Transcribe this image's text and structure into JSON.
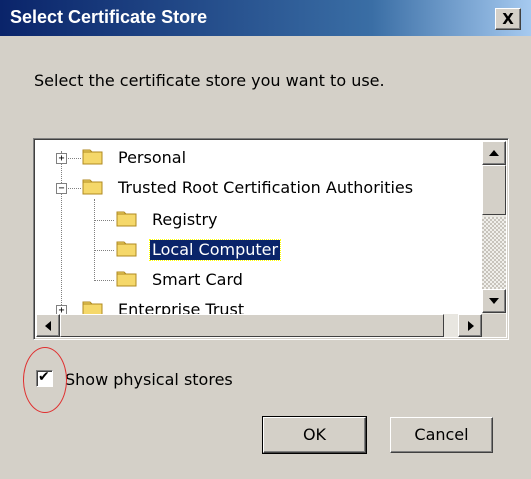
{
  "dialog": {
    "title": "Select Certificate Store",
    "close_glyph": "X",
    "prompt": "Select the certificate store you want to use."
  },
  "tree": {
    "nodes": [
      {
        "label": "Personal",
        "expander": "+"
      },
      {
        "label": "Trusted Root Certification Authorities",
        "expander": "−"
      },
      {
        "label": "Registry"
      },
      {
        "label": "Local Computer",
        "selected": true
      },
      {
        "label": "Smart Card"
      },
      {
        "label": "Enterprise Trust",
        "expander": "+"
      }
    ],
    "folder_color": "#f5d86a"
  },
  "checkbox": {
    "label": "Show physical stores",
    "checked": true,
    "check_glyph": "✔"
  },
  "buttons": {
    "ok": "OK",
    "cancel": "Cancel"
  },
  "colors": {
    "title_bar": "#0a246a",
    "face": "#d4d0c8",
    "selection": "#0a246a",
    "annotation_circle": "#e03030"
  }
}
